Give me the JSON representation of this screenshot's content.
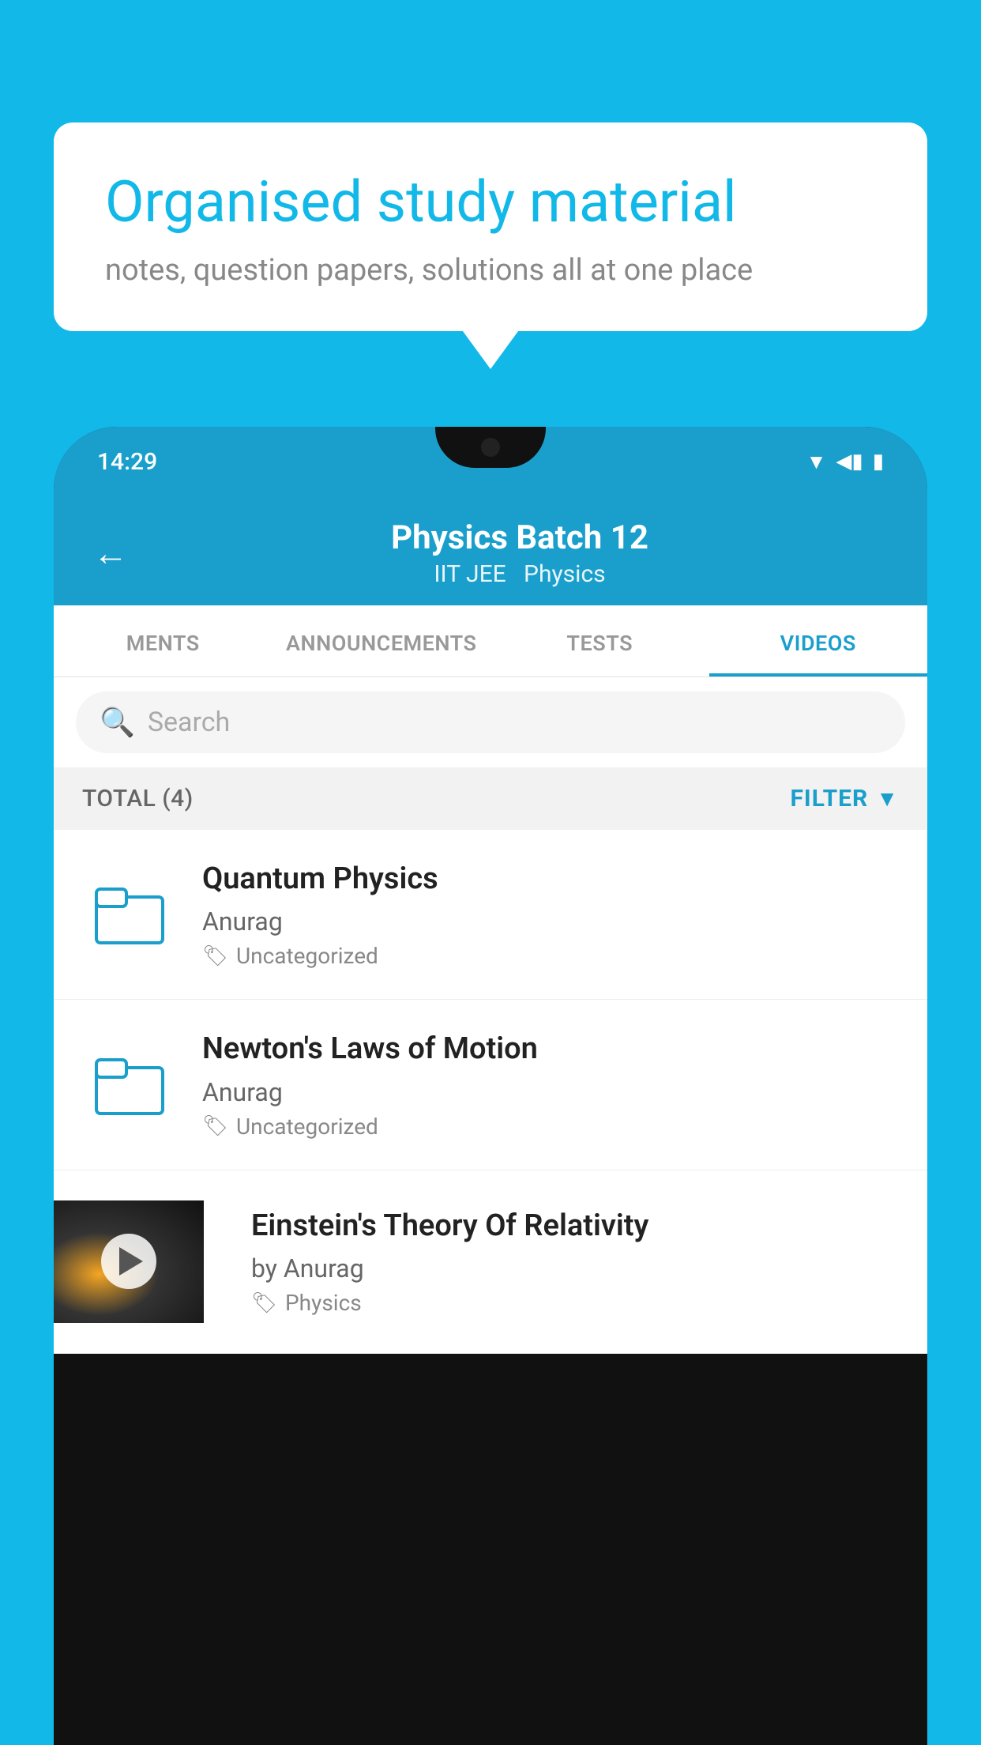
{
  "background_color": "#12b8e8",
  "speech_bubble": {
    "title": "Organised study material",
    "subtitle": "notes, question papers, solutions all at one place"
  },
  "phone": {
    "status_bar": {
      "time": "14:29"
    },
    "header": {
      "back_label": "←",
      "title": "Physics Batch 12",
      "subtitle_parts": [
        "IIT JEE",
        "Physics"
      ]
    },
    "tabs": [
      {
        "label": "MENTS",
        "active": false
      },
      {
        "label": "ANNOUNCEMENTS",
        "active": false
      },
      {
        "label": "TESTS",
        "active": false
      },
      {
        "label": "VIDEOS",
        "active": true
      }
    ],
    "search": {
      "placeholder": "Search"
    },
    "filter_row": {
      "total_label": "TOTAL (4)",
      "filter_label": "FILTER"
    },
    "videos": [
      {
        "type": "folder",
        "title": "Quantum Physics",
        "author": "Anurag",
        "tag": "Uncategorized",
        "has_thumbnail": false
      },
      {
        "type": "folder",
        "title": "Newton's Laws of Motion",
        "author": "Anurag",
        "tag": "Uncategorized",
        "has_thumbnail": false
      },
      {
        "type": "video",
        "title": "Einstein's Theory Of Relativity",
        "author": "by Anurag",
        "tag": "Physics",
        "has_thumbnail": true
      }
    ]
  }
}
